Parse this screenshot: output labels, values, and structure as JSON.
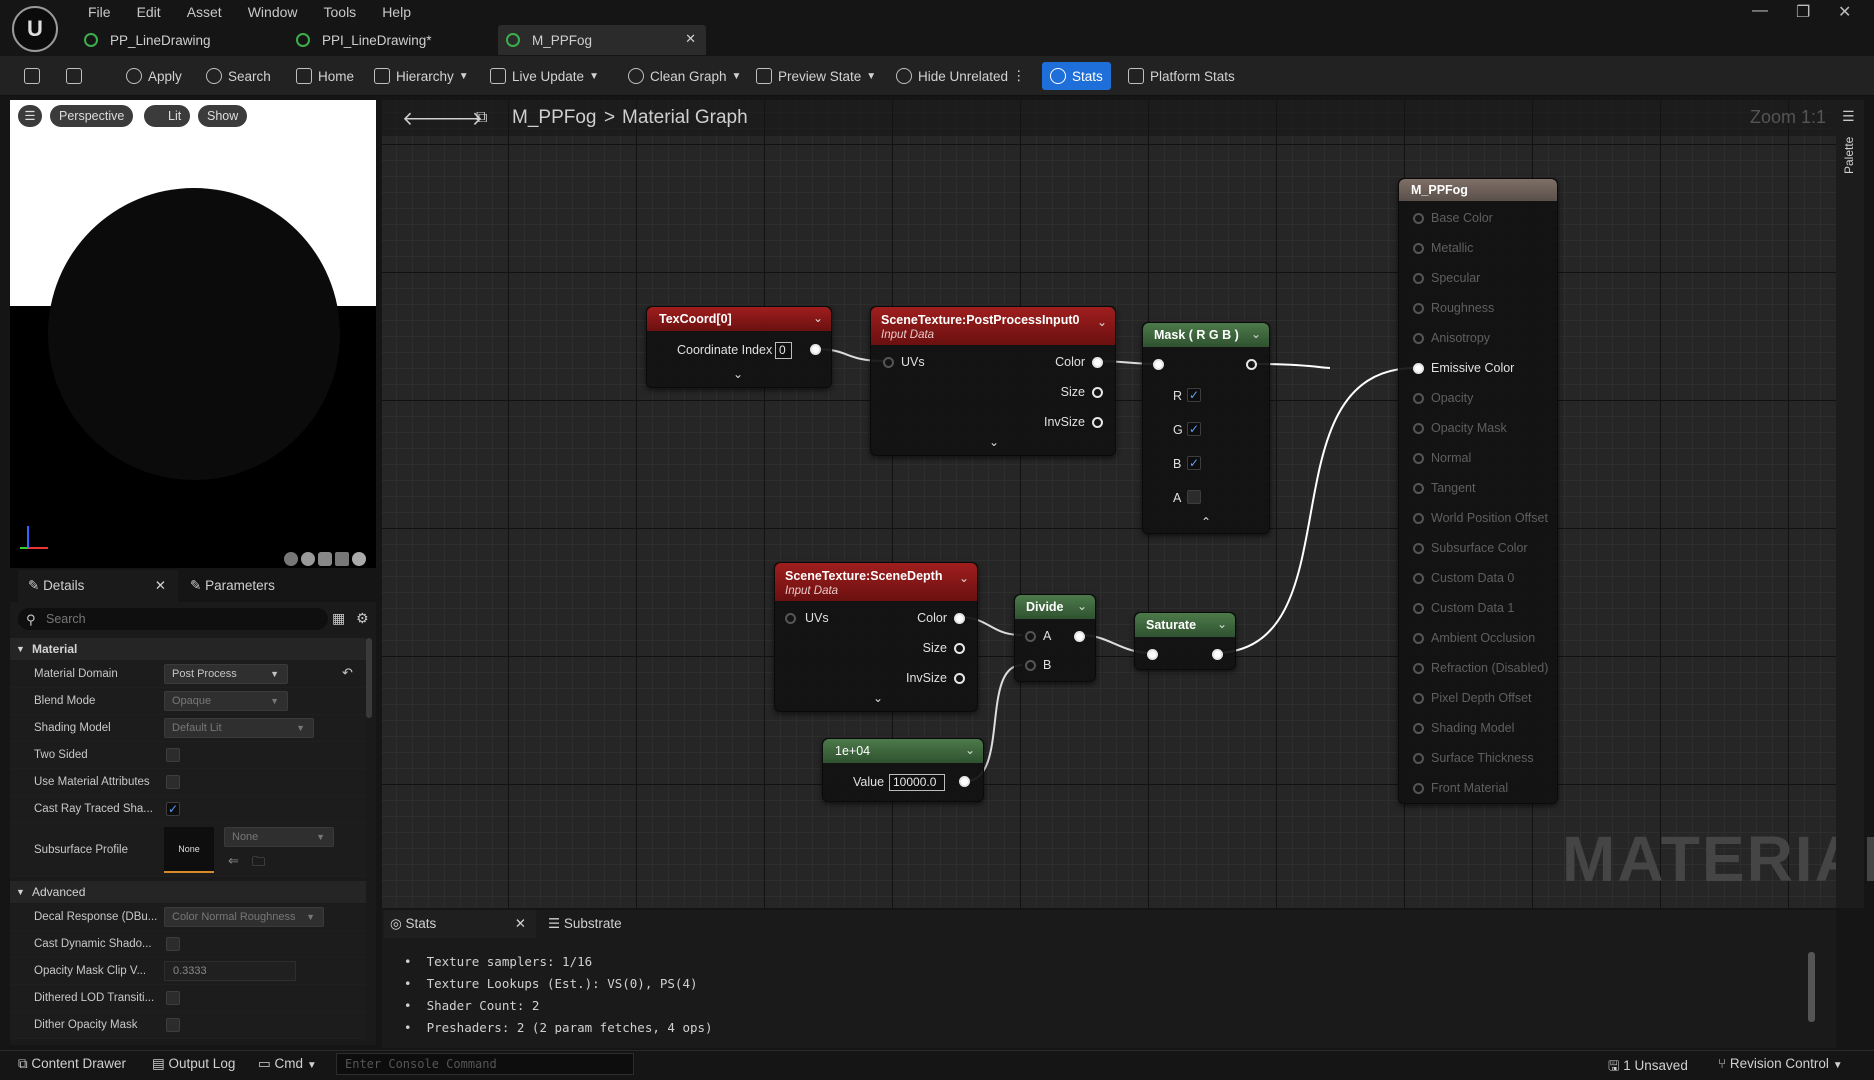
{
  "menu": [
    "File",
    "Edit",
    "Asset",
    "Window",
    "Tools",
    "Help"
  ],
  "tabs": [
    {
      "label": "PP_LineDrawing"
    },
    {
      "label": "PPI_LineDrawing*"
    },
    {
      "label": "M_PPFog"
    }
  ],
  "toolbar": {
    "apply": "Apply",
    "search": "Search",
    "home": "Home",
    "hierarchy": "Hierarchy",
    "live_update": "Live Update",
    "clean_graph": "Clean Graph",
    "preview_state": "Preview State",
    "hide_unrelated": "Hide Unrelated",
    "stats": "Stats",
    "platform_stats": "Platform Stats"
  },
  "viewport": {
    "perspective": "Perspective",
    "lit": "Lit",
    "show": "Show"
  },
  "details": {
    "tab_details": "Details",
    "tab_parameters": "Parameters",
    "search_placeholder": "Search",
    "cat_material": "Material",
    "cat_advanced": "Advanced",
    "material_domain": {
      "label": "Material Domain",
      "value": "Post Process"
    },
    "blend_mode": {
      "label": "Blend Mode",
      "value": "Opaque"
    },
    "shading_model": {
      "label": "Shading Model",
      "value": "Default Lit"
    },
    "two_sided": {
      "label": "Two Sided",
      "checked": false
    },
    "use_material_attributes": {
      "label": "Use Material Attributes",
      "checked": false
    },
    "cast_ray_traced": {
      "label": "Cast Ray Traced Sha...",
      "checked": true
    },
    "subsurface_profile": {
      "label": "Subsurface Profile",
      "thumb": "None",
      "value": "None"
    },
    "decal_response": {
      "label": "Decal Response (DBu...",
      "value": "Color Normal Roughness"
    },
    "cast_dynamic_shadow": {
      "label": "Cast Dynamic Shado...",
      "checked": false
    },
    "opacity_mask_clip": {
      "label": "Opacity Mask Clip V...",
      "value": "0.3333"
    },
    "dithered_lod": {
      "label": "Dithered LOD Transiti...",
      "checked": false
    },
    "dither_opacity": {
      "label": "Dither Opacity Mask",
      "checked": false
    }
  },
  "graph": {
    "breadcrumb_root": "M_PPFog",
    "breadcrumb_sep": ">",
    "breadcrumb_leaf": "Material Graph",
    "zoom": "Zoom 1:1",
    "watermark": "MATERIAL",
    "palette": "Palette"
  },
  "nodes": {
    "texcoord": {
      "title": "TexCoord[0]",
      "pin_label": "Coordinate Index",
      "value": "0"
    },
    "postprocess": {
      "title": "SceneTexture:PostProcessInput0",
      "subtitle": "Input Data",
      "in": "UVs",
      "outs": [
        "Color",
        "Size",
        "InvSize"
      ]
    },
    "mask": {
      "title": "Mask ( R G B )",
      "channels": [
        {
          "name": "R",
          "checked": true
        },
        {
          "name": "G",
          "checked": true
        },
        {
          "name": "B",
          "checked": true
        },
        {
          "name": "A",
          "checked": false
        }
      ]
    },
    "scenedepth": {
      "title": "SceneTexture:SceneDepth",
      "subtitle": "Input Data",
      "in": "UVs",
      "outs": [
        "Color",
        "Size",
        "InvSize"
      ]
    },
    "divide": {
      "title": "Divide",
      "a": "A",
      "b": "B"
    },
    "saturate": {
      "title": "Saturate"
    },
    "constant": {
      "title": "1e+04",
      "label": "Value",
      "value": "10000.0"
    },
    "result": {
      "title": "M_PPFog",
      "inputs": [
        {
          "name": "Base Color",
          "active": false
        },
        {
          "name": "Metallic",
          "active": false
        },
        {
          "name": "Specular",
          "active": false
        },
        {
          "name": "Roughness",
          "active": false
        },
        {
          "name": "Anisotropy",
          "active": false
        },
        {
          "name": "Emissive Color",
          "active": true
        },
        {
          "name": "Opacity",
          "active": false
        },
        {
          "name": "Opacity Mask",
          "active": false
        },
        {
          "name": "Normal",
          "active": false
        },
        {
          "name": "Tangent",
          "active": false
        },
        {
          "name": "World Position Offset",
          "active": false
        },
        {
          "name": "Subsurface Color",
          "active": false
        },
        {
          "name": "Custom Data 0",
          "active": false
        },
        {
          "name": "Custom Data 1",
          "active": false
        },
        {
          "name": "Ambient Occlusion",
          "active": false
        },
        {
          "name": "Refraction (Disabled)",
          "active": false
        },
        {
          "name": "Pixel Depth Offset",
          "active": false
        },
        {
          "name": "Shading Model",
          "active": false
        },
        {
          "name": "Surface Thickness",
          "active": false
        },
        {
          "name": "Front Material",
          "active": false
        }
      ]
    }
  },
  "bottom": {
    "tab_stats": "Stats",
    "tab_substrate": "Substrate",
    "lines": [
      "Texture samplers: 1/16",
      "Texture Lookups (Est.): VS(0), PS(4)",
      "Shader Count: 2",
      "Preshaders: 2  (2 param fetches, 4 ops)"
    ]
  },
  "status": {
    "content_drawer": "Content Drawer",
    "output_log": "Output Log",
    "cmd": "Cmd",
    "console_placeholder": "Enter Console Command",
    "unsaved": "1 Unsaved",
    "revision_control": "Revision Control"
  }
}
